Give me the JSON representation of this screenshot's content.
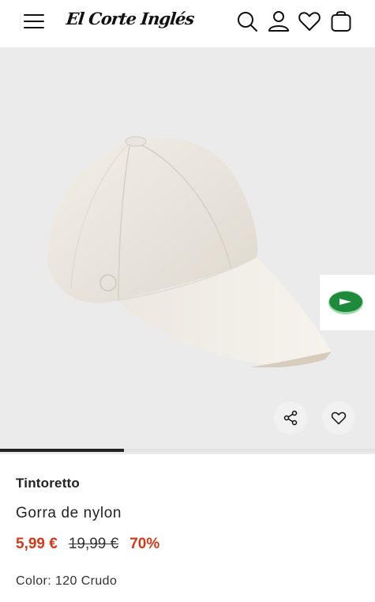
{
  "header": {
    "logo_text": "El Corte Inglés",
    "icons": [
      "menu-icon",
      "search-icon",
      "account-icon",
      "heart-icon",
      "bag-icon"
    ]
  },
  "gallery": {
    "image_alt": "Gorra de nylon",
    "progress": 0.33,
    "actions": [
      "share-icon",
      "heart-icon"
    ],
    "widget_icon": "play-arrow-icon",
    "widget_color": "#1e8a3b"
  },
  "product": {
    "brand": "Tintoretto",
    "name": "Gorra de nylon",
    "price_current": "5,99 €",
    "price_original": "19,99 €",
    "discount": "70%",
    "color_label": "Color:",
    "color_value": "120 Crudo"
  },
  "colors": {
    "sale": "#d6381a",
    "text": "#222222",
    "background": "#ebebeb"
  }
}
